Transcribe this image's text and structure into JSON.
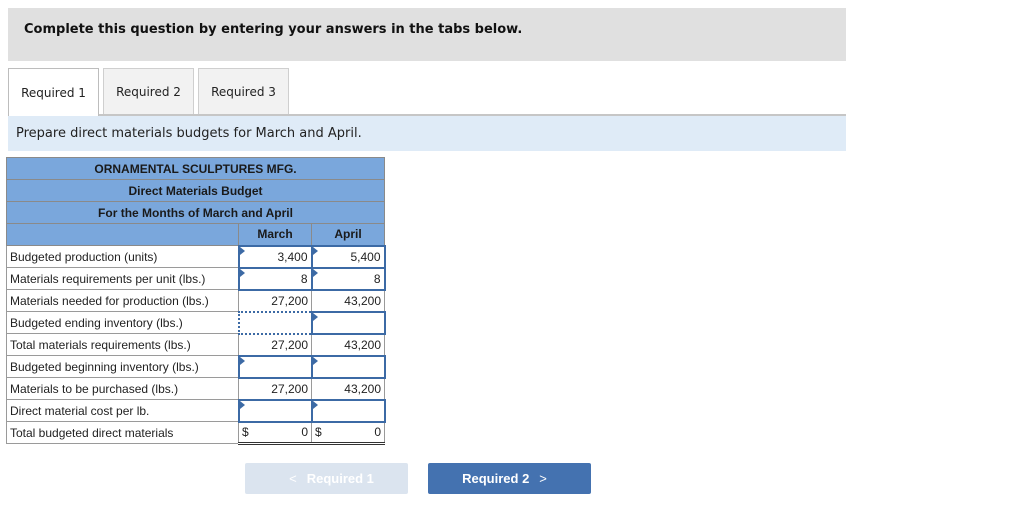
{
  "banner": {
    "text": "Complete this question by entering your answers in the tabs below."
  },
  "tabs": [
    {
      "label": "Required 1",
      "active": true
    },
    {
      "label": "Required 2",
      "active": false
    },
    {
      "label": "Required 3",
      "active": false
    }
  ],
  "instruction": "Prepare direct materials budgets for March and April.",
  "budget": {
    "company": "ORNAMENTAL SCULPTURES MFG.",
    "title": "Direct Materials Budget",
    "period": "For the Months of March and April",
    "columns": [
      "March",
      "April"
    ],
    "rows": [
      {
        "label": "Budgeted production (units)",
        "march": "3,400",
        "april": "5,400"
      },
      {
        "label": "Materials requirements per unit (lbs.)",
        "march": "8",
        "april": "8"
      },
      {
        "label": "Materials needed for production (lbs.)",
        "march": "27,200",
        "april": "43,200"
      },
      {
        "label": "Budgeted ending inventory (lbs.)",
        "march": "",
        "april": ""
      },
      {
        "label": "Total materials requirements (lbs.)",
        "march": "27,200",
        "april": "43,200"
      },
      {
        "label": "Budgeted beginning inventory (lbs.)",
        "march": "",
        "april": ""
      },
      {
        "label": "Materials to be purchased (lbs.)",
        "march": "27,200",
        "april": "43,200"
      },
      {
        "label": "Direct material cost per lb.",
        "march": "",
        "april": ""
      },
      {
        "label": "Total budgeted direct materials",
        "march": "0",
        "april": "0",
        "currency": "$"
      }
    ]
  },
  "nav": {
    "prev_label": "Required 1",
    "next_label": "Required 2",
    "prev_icon": "chevron-left-icon",
    "next_icon": "chevron-right-icon"
  }
}
